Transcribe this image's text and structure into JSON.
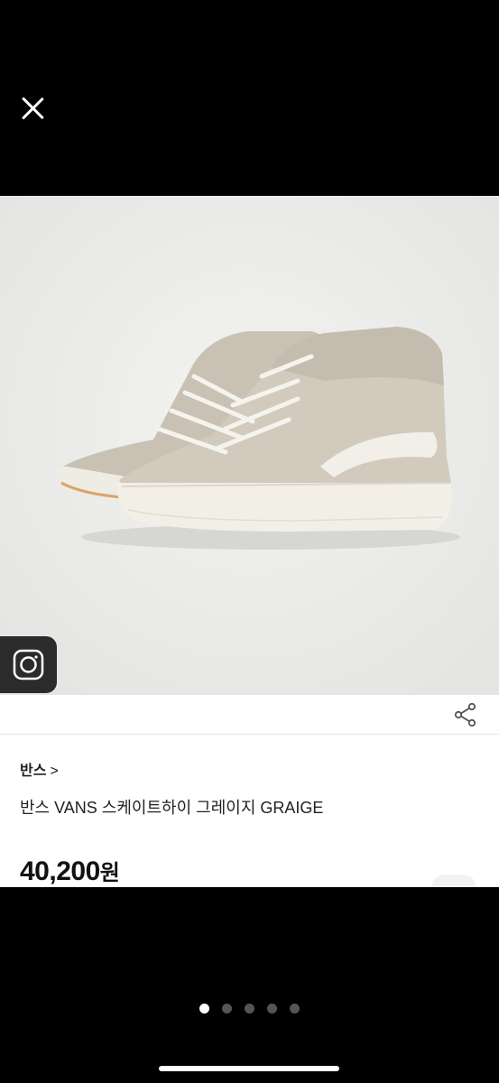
{
  "viewer": {
    "close_icon": "close-icon",
    "instagram_icon": "instagram-icon",
    "share_icon": "share-icon"
  },
  "product": {
    "brand": "반스",
    "brand_chevron": ">",
    "title": "반스 VANS 스케이트하이 그레이지 GRAIGE",
    "price": "40,200",
    "price_unit": "원"
  },
  "pagination": {
    "total": 5,
    "current": 1
  },
  "colors": {
    "background": "#000000",
    "card": "#ffffff",
    "shoe": "#cdc6b9",
    "sole": "#f4f1e9"
  }
}
